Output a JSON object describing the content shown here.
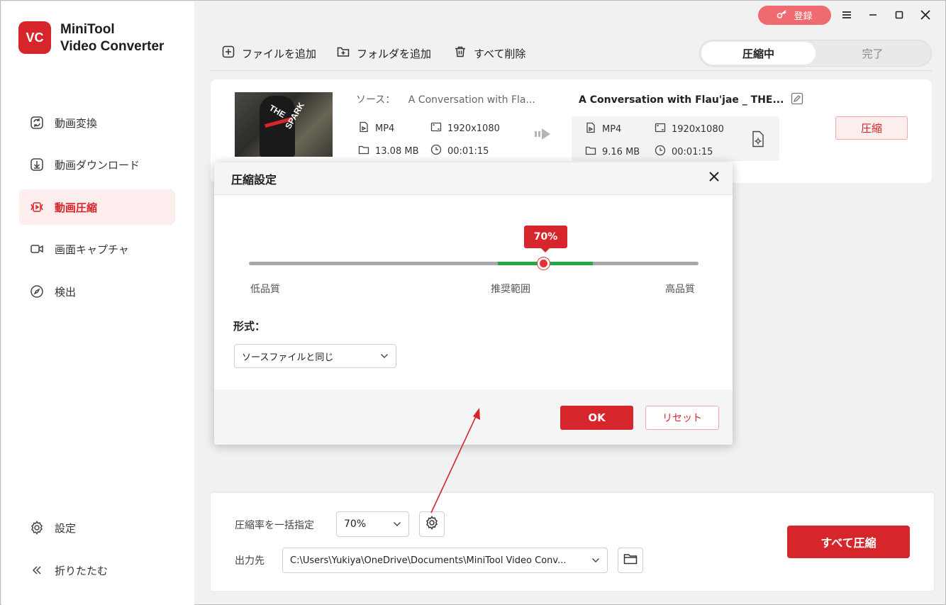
{
  "app": {
    "brand_line1": "MiniTool",
    "brand_line2": "Video Converter",
    "logo_text": "VC",
    "accent_color": "#d6262b"
  },
  "topbar": {
    "login_label": "登録"
  },
  "sidebar": {
    "items": [
      {
        "label": "動画変換",
        "icon": "convert-icon"
      },
      {
        "label": "動画ダウンロード",
        "icon": "download-icon"
      },
      {
        "label": "動画圧縮",
        "icon": "compress-icon",
        "active": true
      },
      {
        "label": "画面キャプチャ",
        "icon": "video-camera-icon"
      },
      {
        "label": "検出",
        "icon": "compass-icon"
      }
    ],
    "settings_label": "設定",
    "collapse_label": "折りたたむ"
  },
  "toolbar": {
    "add_file": "ファイルを追加",
    "add_folder": "フォルダを追加",
    "delete_all": "すべて削除",
    "tabs": [
      "圧縮中",
      "完了"
    ]
  },
  "file": {
    "source_label": "ソース：",
    "source_name": "A Conversation with Fla...",
    "src_format": "MP4",
    "src_resolution": "1920x1080",
    "src_size": "13.08 MB",
    "src_duration": "00:01:15",
    "target_name": "A Conversation with Flau'jae _ THE...",
    "tgt_format": "MP4",
    "tgt_resolution": "1920x1080",
    "tgt_size": "9.16 MB",
    "tgt_duration": "00:01:15",
    "compress_label": "圧縮",
    "thumb_text1": "THE",
    "thumb_text2": "SPARK"
  },
  "modal": {
    "title": "圧縮設定",
    "slider_value_label": "70%",
    "slider_value": 70,
    "low_label": "低品質",
    "recommended_label": "推奨範囲",
    "high_label": "高品質",
    "format_label": "形式：",
    "format_value": "ソースファイルと同じ",
    "ok_label": "OK",
    "reset_label": "リセット"
  },
  "bottom": {
    "ratio_label": "圧縮率を一括指定",
    "ratio_value": "70%",
    "output_label": "出力先",
    "output_path": "C:\\Users\\Yukiya\\OneDrive\\Documents\\MiniTool Video Conv...",
    "compress_all_label": "すべて圧縮"
  }
}
